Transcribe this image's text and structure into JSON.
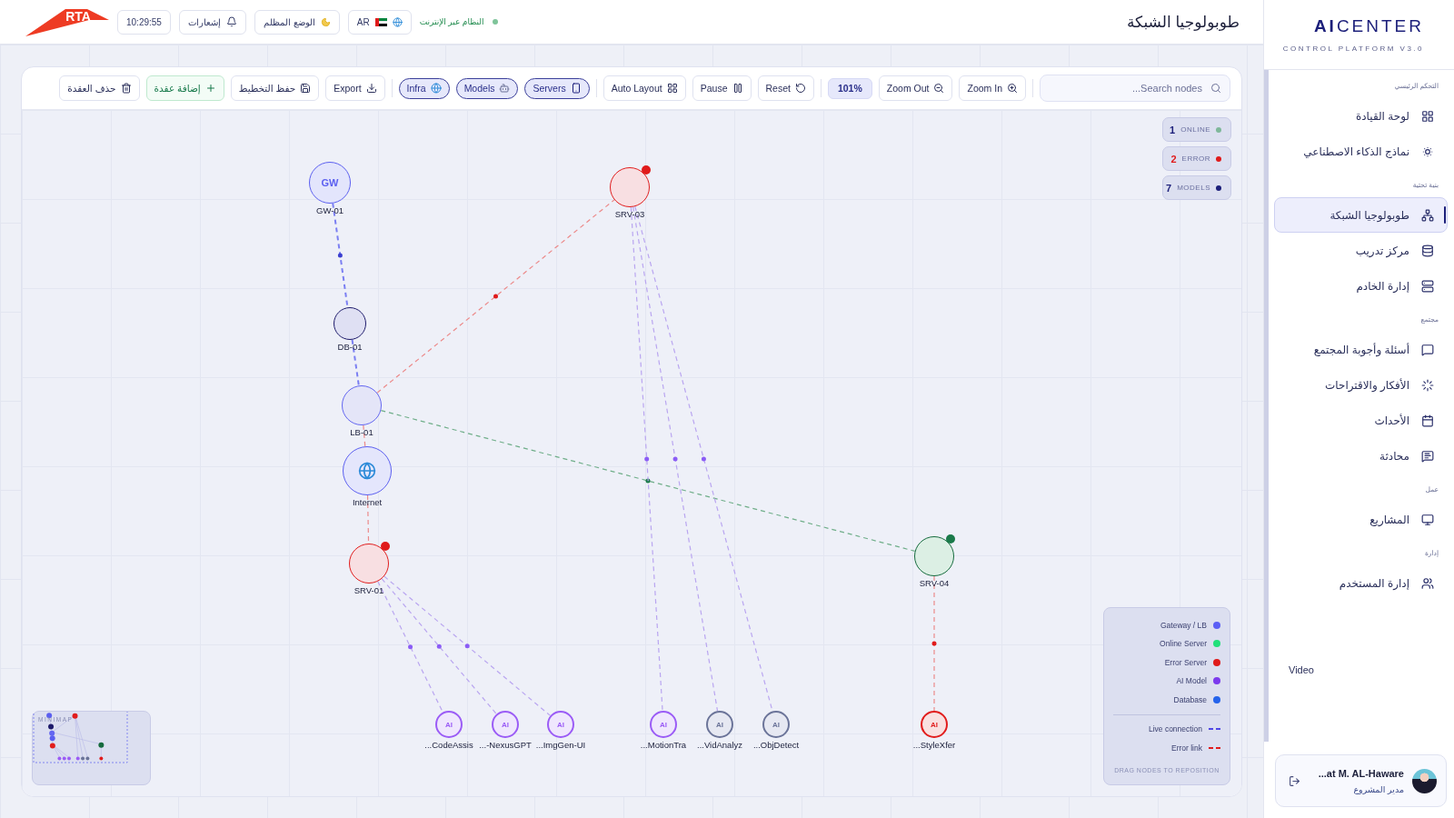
{
  "header": {
    "title": "طوبولوجيا الشبكة",
    "logo": "RTA",
    "clock": "10:29:55",
    "notifications": "إشعارات",
    "theme": "الوضع المظلم",
    "language": "AR",
    "status": {
      "label": "النظام عبر الإنترنت",
      "online": true
    }
  },
  "toolbar": {
    "search": {
      "placeholder": "Search nodes..."
    },
    "groups": [
      [
        {
          "kind": "button",
          "label": "Zoom In"
        },
        {
          "kind": "button",
          "label": "Zoom Out"
        },
        {
          "kind": "zoom",
          "label": "101%"
        }
      ],
      [
        {
          "kind": "button",
          "label": "Reset"
        },
        {
          "kind": "button",
          "label": "Pause"
        },
        {
          "kind": "button",
          "label": "Auto Layout"
        }
      ],
      [
        {
          "kind": "filter",
          "label": "Servers",
          "selected": true
        },
        {
          "kind": "filter",
          "label": "Models",
          "selected": true
        },
        {
          "kind": "filter",
          "label": "Infra",
          "selected": true
        }
      ],
      [
        {
          "kind": "button",
          "label": "Export"
        },
        {
          "kind": "button",
          "label": "حفظ التخطيط"
        },
        {
          "kind": "add",
          "label": "إضافة عقدة"
        },
        {
          "kind": "button",
          "label": "حذف العقدة"
        }
      ]
    ]
  },
  "stats": [
    {
      "count": "1",
      "label": "ONLINE",
      "color": "#7fb89a",
      "alert": false
    },
    {
      "count": "2",
      "label": "ERROR",
      "color": "#e01b1b",
      "alert": true
    },
    {
      "count": "7",
      "label": "MODELS",
      "color": "#1c1f7a",
      "alert": false
    }
  ],
  "topology": {
    "nodes": [
      {
        "kind": "gateway",
        "glyph": "GW",
        "label": "GW-01",
        "children": [
          {
            "kind": "database",
            "label": "DB-01",
            "children": [
              {
                "kind": "balancer",
                "label": "LB-01",
                "children": [
                  {
                    "kind": "server",
                    "error": false,
                    "label": "SRV-04",
                    "children": [
                      {
                        "kind": "model",
                        "error": true,
                        "glyph": "AI",
                        "label": "...StyleXfer"
                      }
                    ]
                  },
                  {
                    "kind": "server",
                    "error": true,
                    "label": "SRV-03",
                    "children": [
                      {
                        "kind": "model",
                        "error": false,
                        "active": false,
                        "glyph": "AI",
                        "label": "...ObjDetect"
                      },
                      {
                        "kind": "model",
                        "error": false,
                        "active": false,
                        "glyph": "AI",
                        "label": "...VidAnalyz"
                      },
                      {
                        "kind": "model",
                        "error": false,
                        "active": true,
                        "glyph": "AI",
                        "label": "...MotionTra"
                      }
                    ]
                  },
                  {
                    "kind": "internet",
                    "label": "Internet",
                    "children": [
                      {
                        "kind": "server",
                        "error": true,
                        "label": "SRV-01",
                        "children": [
                          {
                            "kind": "model",
                            "error": false,
                            "active": true,
                            "glyph": "AI",
                            "label": "...ImgGen-UI"
                          },
                          {
                            "kind": "model",
                            "error": false,
                            "active": true,
                            "glyph": "AI",
                            "label": "...-NexusGPT"
                          },
                          {
                            "kind": "model",
                            "error": false,
                            "active": true,
                            "glyph": "AI",
                            "label": "...CodeAssis"
                          }
                        ]
                      }
                    ]
                  }
                ]
              }
            ]
          }
        ]
      }
    ]
  },
  "legend": {
    "items": [
      {
        "label": "Gateway / LB",
        "color": "#5b5ff5",
        "kind": "dot"
      },
      {
        "label": "Online Server",
        "color": "#22e07a",
        "kind": "dot"
      },
      {
        "label": "Error Server",
        "color": "#e01b1b",
        "kind": "dot"
      },
      {
        "label": "AI Model",
        "color": "#7c3aed",
        "kind": "dot"
      },
      {
        "label": "Database",
        "color": "#2563eb",
        "kind": "dot"
      },
      {
        "label": "Live connection",
        "color": "#4f46e5",
        "kind": "dash"
      },
      {
        "label": "Error link",
        "color": "#e01b1b",
        "kind": "dash"
      }
    ],
    "hint": "DRAG NODES TO REPOSITION"
  },
  "minimap": {
    "title": "MINIMAP"
  },
  "sidebar": {
    "brand": {
      "strong": "AI",
      "rest": "CENTER",
      "tagline": "CONTROL PLATFORM V3.0"
    },
    "sections": [
      {
        "title": "التحكم الرئيسي",
        "items": [
          {
            "label": "لوحة القيادة",
            "selected": false
          },
          {
            "label": "نماذج الذكاء الاصطناعي",
            "selected": false
          }
        ]
      },
      {
        "title": "بنية تحتية",
        "items": [
          {
            "label": "طوبولوجيا الشبكة",
            "selected": true
          },
          {
            "label": "مركز تدريب",
            "selected": false
          },
          {
            "label": "إدارة الخادم",
            "selected": false
          }
        ]
      },
      {
        "title": "مجتمع",
        "items": [
          {
            "label": "أسئلة وأجوبة المجتمع",
            "selected": false
          },
          {
            "label": "الأفكار والاقتراحات",
            "selected": false
          },
          {
            "label": "الأحداث",
            "selected": false
          },
          {
            "label": "محادثة",
            "selected": false
          }
        ]
      },
      {
        "title": "عمل",
        "items": [
          {
            "label": "المشاريع",
            "selected": false
          }
        ]
      },
      {
        "title": "إدارة",
        "items": [
          {
            "label": "إدارة المستخدم",
            "selected": false
          }
        ]
      }
    ],
    "extra": "Video",
    "user": {
      "name": "...at M. AL-Haware",
      "role": "مدير المشروع"
    }
  }
}
